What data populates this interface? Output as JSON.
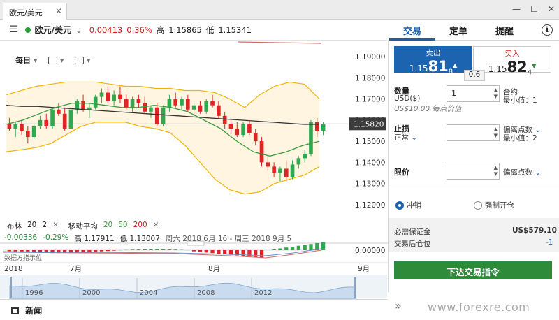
{
  "window": {
    "tab_title": "欧元/美元",
    "close": "✕",
    "ctl_min": "—",
    "ctl_max": "☐",
    "ctl_close": "✕"
  },
  "instrument": {
    "menu": "☰",
    "name": "欧元/美元",
    "dropdown": "⌄",
    "change": "0.00413",
    "change_pct": "0.36%",
    "high_label": "高",
    "high": "1.15865",
    "low_label": "低",
    "low": "1.15341"
  },
  "toolbar": {
    "period": "每日",
    "caret": "▾"
  },
  "price_axis": [
    "1.19000",
    "1.18000",
    "1.17000",
    "1.16000",
    "1.15820",
    "1.15000",
    "1.14000",
    "1.13000",
    "1.12000"
  ],
  "current_price": "1.15820",
  "indicator_axis": "0.00000",
  "legend": {
    "bb_label": "布林",
    "bb_p1": "20",
    "bb_p2": "2",
    "ma_label": "移动平均",
    "ma1": "20",
    "ma2": "50",
    "ma3": "200",
    "close": "✕"
  },
  "info": {
    "chg": "-0.00336",
    "chg_pct": "-0.29%",
    "high": "高 1.17911",
    "low": "低 1.13007",
    "range": "周六 2018 6月 16 - 周三 2018 9月 5"
  },
  "indicator_label": "数据方指示位",
  "time_axis": [
    "2018",
    "7月",
    "8月",
    "9月"
  ],
  "navigator_years": [
    "1996",
    "2000",
    "2004",
    "2008",
    "2012"
  ],
  "news": "新闻",
  "right_tabs": [
    "交易",
    "定单",
    "提醒"
  ],
  "info_icon": "i",
  "sell": {
    "label": "卖出",
    "prefix": "1.15",
    "big": "81",
    "small": "8",
    "arrow": "▲"
  },
  "buy": {
    "label": "买入",
    "prefix": "1.15",
    "big": "82",
    "small": "4",
    "arrow": "▼"
  },
  "spread": "0.6",
  "form": {
    "qty_label": "数量",
    "qty_unit": "USD($)",
    "qty_value": "1",
    "qty_note": "US$10.00 每点价值",
    "contract_label": "合约",
    "contract_min": "最小值：1",
    "stop_label": "止损",
    "stop_type": "正常",
    "stop_dev": "偏离点数",
    "stop_min": "最小值：2",
    "limit_label": "限价",
    "limit_dev": "偏离点数"
  },
  "radio": {
    "close_label": "冲销",
    "hedge_label": "强制开仓"
  },
  "margin": {
    "label": "必需保证金",
    "value": "US$579.10",
    "pos_label": "交易后仓位",
    "pos_value": "-1"
  },
  "place_order": "下达交易指令",
  "expand": "»",
  "watermark": "www.forexre.com",
  "colors": {
    "bull": "#2fa84f",
    "bear": "#e02424",
    "band": "#f2b400",
    "ma_dark": "#333333",
    "ma_green": "#3d9b3d",
    "accent": "#1c64b0",
    "order": "#2e8b3a"
  },
  "chart_data": {
    "type": "candlestick",
    "ylim": [
      1.115,
      1.195
    ],
    "yticks": [
      1.19,
      1.18,
      1.17,
      1.16,
      1.15,
      1.14,
      1.13,
      1.12
    ],
    "candles": [
      [
        1.158,
        1.161,
        1.155,
        1.156
      ],
      [
        1.156,
        1.159,
        1.152,
        1.158
      ],
      [
        1.158,
        1.16,
        1.153,
        1.155
      ],
      [
        1.155,
        1.157,
        1.149,
        1.152
      ],
      [
        1.152,
        1.158,
        1.151,
        1.157
      ],
      [
        1.157,
        1.162,
        1.156,
        1.16
      ],
      [
        1.16,
        1.163,
        1.156,
        1.157
      ],
      [
        1.157,
        1.166,
        1.156,
        1.165
      ],
      [
        1.165,
        1.168,
        1.162,
        1.163
      ],
      [
        1.163,
        1.166,
        1.155,
        1.156
      ],
      [
        1.156,
        1.166,
        1.155,
        1.165
      ],
      [
        1.165,
        1.17,
        1.163,
        1.169
      ],
      [
        1.169,
        1.172,
        1.164,
        1.165
      ],
      [
        1.165,
        1.168,
        1.161,
        1.166
      ],
      [
        1.166,
        1.172,
        1.165,
        1.171
      ],
      [
        1.171,
        1.175,
        1.168,
        1.173
      ],
      [
        1.173,
        1.176,
        1.168,
        1.169
      ],
      [
        1.169,
        1.174,
        1.167,
        1.172
      ],
      [
        1.172,
        1.176,
        1.168,
        1.17
      ],
      [
        1.17,
        1.172,
        1.165,
        1.166
      ],
      [
        1.166,
        1.171,
        1.164,
        1.17
      ],
      [
        1.17,
        1.172,
        1.166,
        1.168
      ],
      [
        1.168,
        1.171,
        1.163,
        1.164
      ],
      [
        1.164,
        1.167,
        1.161,
        1.166
      ],
      [
        1.166,
        1.168,
        1.157,
        1.158
      ],
      [
        1.158,
        1.167,
        1.157,
        1.166
      ],
      [
        1.166,
        1.172,
        1.164,
        1.17
      ],
      [
        1.17,
        1.173,
        1.166,
        1.167
      ],
      [
        1.167,
        1.171,
        1.165,
        1.17
      ],
      [
        1.17,
        1.172,
        1.164,
        1.165
      ],
      [
        1.165,
        1.168,
        1.162,
        1.167
      ],
      [
        1.167,
        1.169,
        1.163,
        1.164
      ],
      [
        1.164,
        1.17,
        1.163,
        1.169
      ],
      [
        1.169,
        1.172,
        1.166,
        1.167
      ],
      [
        1.167,
        1.169,
        1.161,
        1.162
      ],
      [
        1.162,
        1.164,
        1.156,
        1.158
      ],
      [
        1.158,
        1.16,
        1.154,
        1.156
      ],
      [
        1.156,
        1.159,
        1.152,
        1.153
      ],
      [
        1.153,
        1.159,
        1.152,
        1.158
      ],
      [
        1.158,
        1.16,
        1.153,
        1.154
      ],
      [
        1.154,
        1.156,
        1.148,
        1.15
      ],
      [
        1.15,
        1.152,
        1.138,
        1.14
      ],
      [
        1.14,
        1.143,
        1.136,
        1.138
      ],
      [
        1.138,
        1.14,
        1.133,
        1.135
      ],
      [
        1.135,
        1.138,
        1.131,
        1.137
      ],
      [
        1.137,
        1.141,
        1.131,
        1.133
      ],
      [
        1.133,
        1.141,
        1.132,
        1.139
      ],
      [
        1.139,
        1.143,
        1.137,
        1.142
      ],
      [
        1.142,
        1.146,
        1.14,
        1.144
      ],
      [
        1.144,
        1.16,
        1.143,
        1.159
      ],
      [
        1.159,
        1.161,
        1.152,
        1.155
      ],
      [
        1.155,
        1.159,
        1.153,
        1.158
      ]
    ],
    "ma_dark": [
      1.167,
      1.1665,
      1.1665,
      1.166,
      1.1655,
      1.165,
      1.1645,
      1.164,
      1.1635,
      1.163,
      1.1625,
      1.162,
      1.1615,
      1.161,
      1.1605,
      1.16,
      1.1595,
      1.159,
      1.1585,
      1.158,
      1.158
    ],
    "ma_green": [
      1.158,
      1.16,
      1.163,
      1.166,
      1.168,
      1.168,
      1.167,
      1.166,
      1.166,
      1.167,
      1.166,
      1.164,
      1.16,
      1.156,
      1.15,
      1.145,
      1.143,
      1.145,
      1.148,
      1.15
    ],
    "bb_upper": [
      1.172,
      1.174,
      1.176,
      1.177,
      1.178,
      1.178,
      1.178,
      1.177,
      1.176,
      1.176,
      1.175,
      1.175,
      1.174,
      1.174,
      1.173,
      1.17,
      1.166,
      1.172,
      1.176,
      1.178,
      1.177,
      1.17
    ],
    "bb_lower": [
      1.145,
      1.146,
      1.147,
      1.149,
      1.153,
      1.157,
      1.159,
      1.159,
      1.159,
      1.157,
      1.156,
      1.154,
      1.148,
      1.14,
      1.132,
      1.127,
      1.125,
      1.126,
      1.13,
      1.132,
      1.134,
      1.138
    ]
  }
}
